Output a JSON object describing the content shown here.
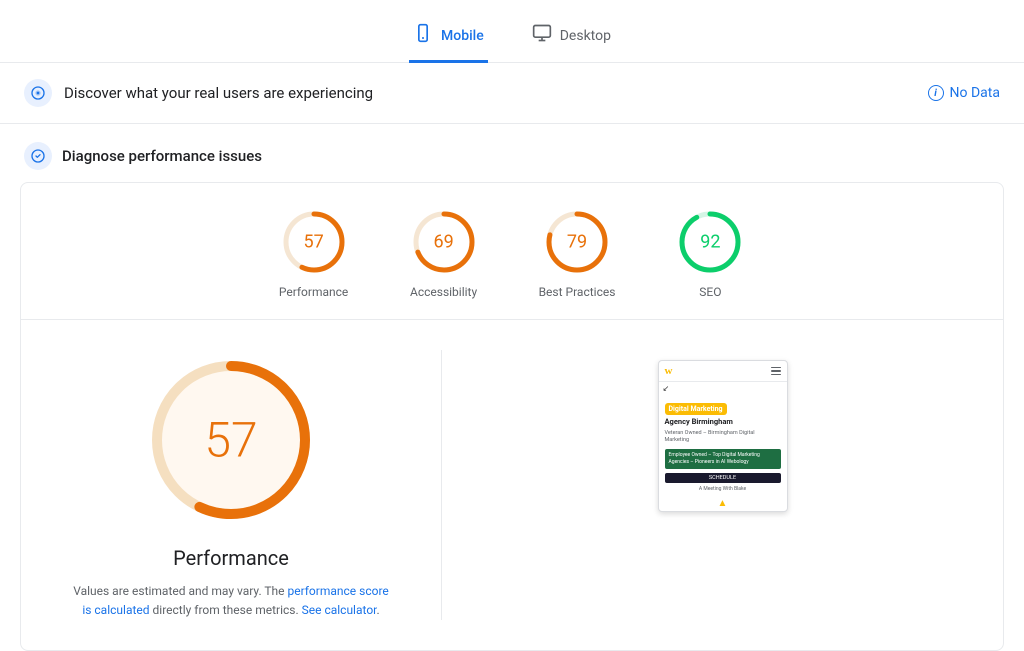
{
  "tabs": [
    {
      "id": "mobile",
      "label": "Mobile",
      "active": true
    },
    {
      "id": "desktop",
      "label": "Desktop",
      "active": false
    }
  ],
  "banner": {
    "text": "Discover what your real users are experiencing",
    "status": "No Data"
  },
  "diagnose": {
    "title": "Diagnose performance issues",
    "scores": [
      {
        "id": "performance",
        "label": "Performance",
        "value": 57,
        "color": "orange",
        "pct": 57
      },
      {
        "id": "accessibility",
        "label": "Accessibility",
        "value": 69,
        "color": "orange",
        "pct": 69
      },
      {
        "id": "best-practices",
        "label": "Best Practices",
        "value": 79,
        "color": "orange",
        "pct": 79
      },
      {
        "id": "seo",
        "label": "SEO",
        "value": 92,
        "color": "green",
        "pct": 92
      }
    ]
  },
  "detail": {
    "score_value": 57,
    "score_label": "Performance",
    "note_text": "Values are estimated and may vary. The ",
    "note_link1": "performance score is calculated",
    "note_mid": " directly from these metrics. ",
    "note_link2": "See calculator",
    "note_end": "."
  },
  "preview": {
    "logo": "w",
    "hero_label": "Digital Marketing",
    "title": "Agency Birmingham",
    "subtitle": "Veteran Owned – Birmingham Digital Marketing",
    "green_text": "Employee Owned – Top Digital Marketing Agencies – Pioneers in AI Webology",
    "button": "SCHEDULE",
    "meeting": "A Meeting With Blake"
  }
}
